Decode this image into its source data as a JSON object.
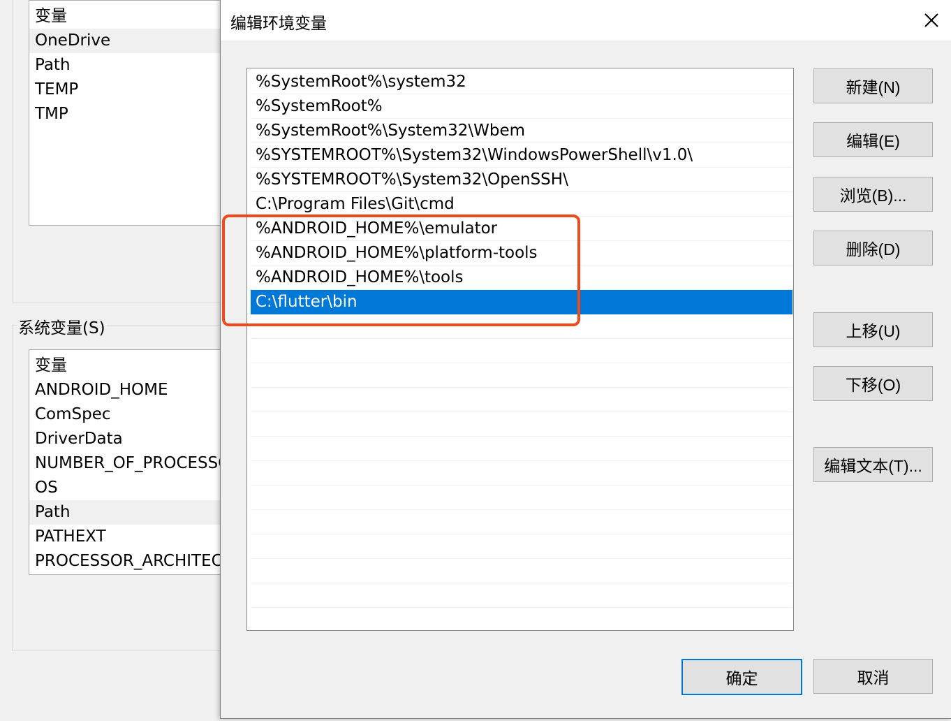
{
  "user_vars": {
    "header": "变量",
    "rows": [
      "OneDrive",
      "Path",
      "TEMP",
      "TMP"
    ]
  },
  "system_vars": {
    "group_label": "系统变量(S)",
    "header": "变量",
    "rows": [
      "ANDROID_HOME",
      "ComSpec",
      "DriverData",
      "NUMBER_OF_PROCESSORS",
      "OS",
      "Path",
      "PATHEXT",
      "PROCESSOR_ARCHITECTURE"
    ]
  },
  "dialog": {
    "title": "编辑环境变量",
    "close_icon": "close-icon",
    "paths": [
      "%SystemRoot%\\system32",
      "%SystemRoot%",
      "%SystemRoot%\\System32\\Wbem",
      "%SYSTEMROOT%\\System32\\WindowsPowerShell\\v1.0\\",
      "%SYSTEMROOT%\\System32\\OpenSSH\\",
      "C:\\Program Files\\Git\\cmd",
      "%ANDROID_HOME%\\emulator",
      "%ANDROID_HOME%\\platform-tools",
      "%ANDROID_HOME%\\tools",
      "C:\\flutter\\bin"
    ],
    "selected_index": 9,
    "buttons": {
      "new": "新建(N)",
      "edit": "编辑(E)",
      "browse": "浏览(B)...",
      "delete": "删除(D)",
      "move_up": "上移(U)",
      "move_down": "下移(O)",
      "edit_text": "编辑文本(T)...",
      "ok": "确定",
      "cancel": "取消"
    },
    "colors": {
      "selection": "#0078d7",
      "annotation": "#f04a1c"
    }
  }
}
